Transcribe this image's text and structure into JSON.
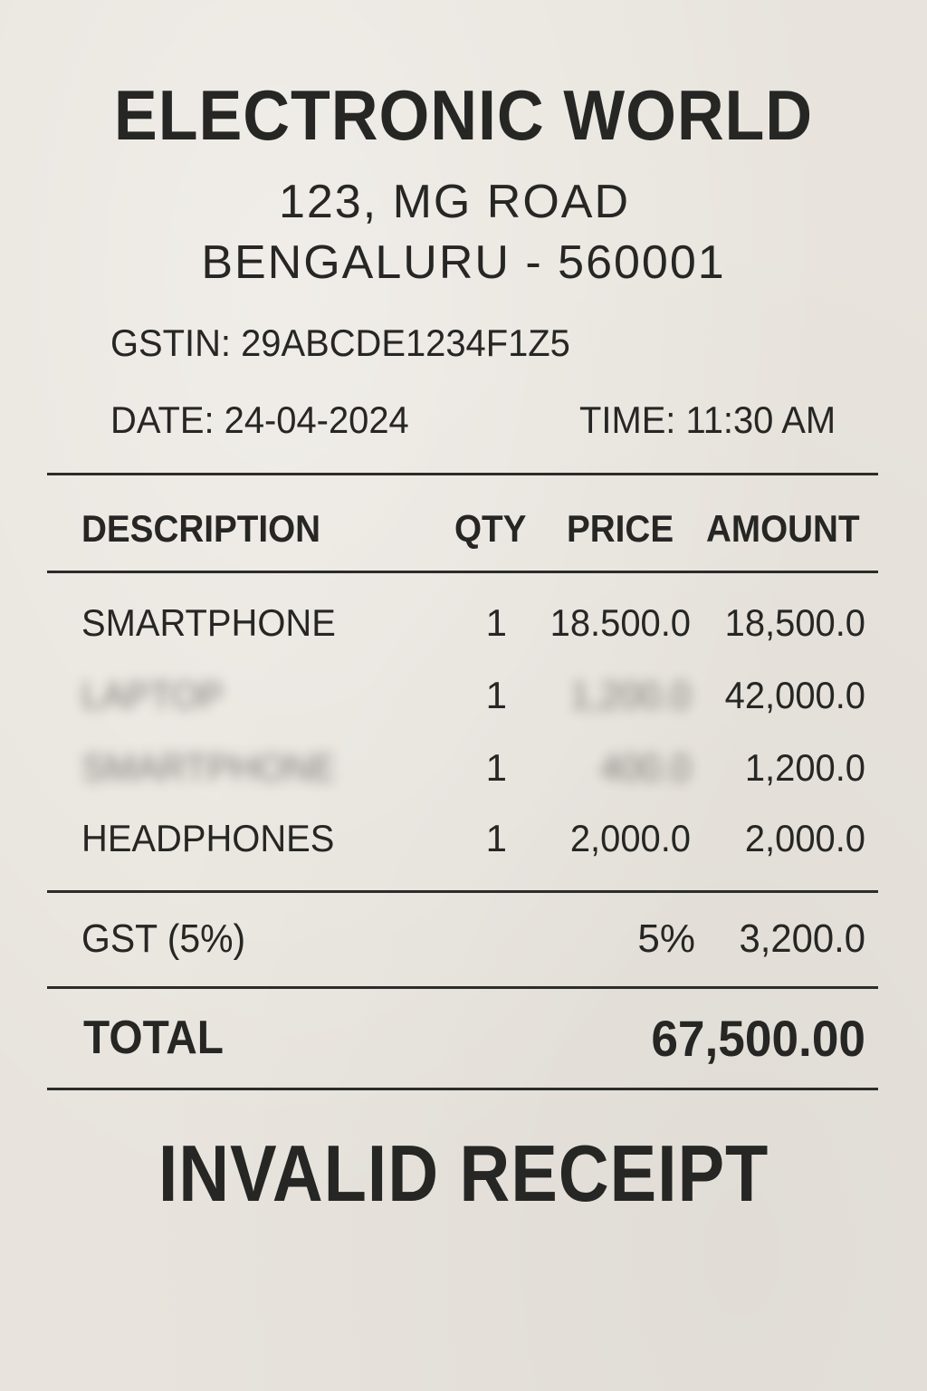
{
  "header": {
    "store_name": "ELECTRONIC WORLD",
    "address_line1": "123, MG ROAD",
    "address_line2": "BENGALURU - 560001",
    "gstin": "GSTIN: 29ABCDE1234F1Z5",
    "date": "DATE: 24-04-2024",
    "time": "TIME: 11:30 AM"
  },
  "columns": {
    "description": "DESCRIPTION",
    "qty": "QTY",
    "price": "PRICE",
    "amount": "AMOUNT"
  },
  "items": [
    {
      "description": "SMARTPHONE",
      "qty": "1",
      "price": "18.500.0",
      "amount": "18,500.0"
    },
    {
      "description": "LAPTOP",
      "qty": "1",
      "price": "1,200.0",
      "amount": "42,000.0"
    },
    {
      "description": "SMARTPHONE",
      "qty": "1",
      "price": "400.0",
      "amount": "1,200.0"
    },
    {
      "description": "HEADPHONES",
      "qty": "1",
      "price": "2,000.0",
      "amount": "2,000.0"
    }
  ],
  "gst": {
    "label": "GST (5%)",
    "rate": "5%",
    "amount": "3,200.0"
  },
  "total": {
    "label": "TOTAL",
    "value": "67,500.00"
  },
  "footer": {
    "stamp": "INVALID RECEIPT"
  }
}
